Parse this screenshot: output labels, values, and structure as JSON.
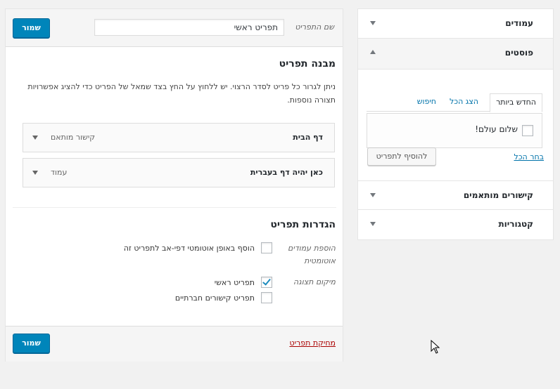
{
  "sidebar": {
    "sections": [
      {
        "title": "עמודים",
        "expanded": false
      },
      {
        "title": "פוסטים",
        "expanded": true
      },
      {
        "title": "קישורים מותאמים",
        "expanded": false
      },
      {
        "title": "קטגוריות",
        "expanded": false
      }
    ],
    "posts": {
      "tabs": [
        "החדש ביותר",
        "הצג הכל",
        "חיפוש"
      ],
      "active_tab": "החדש ביותר",
      "items": [
        {
          "label": "שלום עולם!",
          "checked": false
        }
      ],
      "select_all": "בחר הכל",
      "add_button": "להוסיף לתפריט"
    }
  },
  "menu": {
    "name_label": "שם התפריט",
    "name_value": "תפריט ראשי",
    "save_button": "שמור",
    "structure_title": "מבנה תפריט",
    "structure_help": "ניתן לגרור כל פריט לסדר הרצוי. יש ללחוץ על החץ בצד שמאל של הפריט כדי להציג אפשרויות תצורה נוספות.",
    "items": [
      {
        "title": "דף הבית",
        "type": "קישור מותאם"
      },
      {
        "title": "כאן יהיה דף בעברית",
        "type": "עמוד"
      }
    ],
    "settings_title": "הגדרות תפריט",
    "auto_add_label": "הוספת עמודים אוטומטית",
    "auto_add_option": {
      "label": "הוסף באופן אוטומטי דפי-אב לתפריט זה",
      "checked": false
    },
    "location_label": "מיקום תצוגה",
    "locations": [
      {
        "label": "תפריט ראשי",
        "checked": true
      },
      {
        "label": "תפריט קישורים חברתיים",
        "checked": false
      }
    ],
    "delete_link": "מחיקת תפריט"
  },
  "colors": {
    "primary": "#0085ba",
    "link": "#0073aa",
    "delete": "#a00"
  }
}
